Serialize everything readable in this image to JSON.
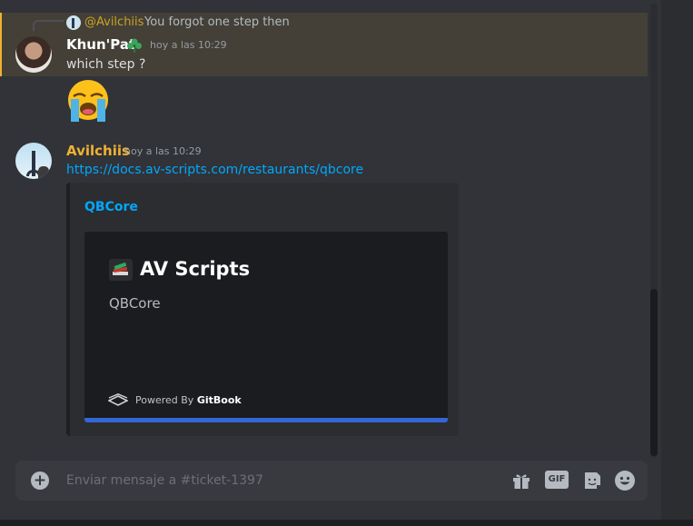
{
  "reply": {
    "mention": "@Avilchiis",
    "text": "You forgot one step then"
  },
  "messages": [
    {
      "author": "Khun'Pat",
      "author_color": "#ffffff",
      "timestamp": "hoy a las 10:29",
      "text": "which step ?",
      "emoji": "loudly-crying-face",
      "highlight_color": "#f0b232"
    },
    {
      "author": "Avilchiis",
      "author_color": "#f0b232",
      "timestamp": "hoy a las 10:29",
      "link": "https://docs.av-scripts.com/restaurants/qbcore",
      "embed": {
        "title": "QBCore",
        "site_name": "AV Scripts",
        "subtitle": "QBCore",
        "powered_prefix": "Powered By ",
        "powered_brand": "GitBook",
        "accent_color": "#3466d6"
      }
    }
  ],
  "composer": {
    "placeholder": "Enviar mensaje a #ticket-1397",
    "value": "",
    "gif_label": "GIF",
    "plus_label": "+"
  },
  "icons": [
    "plus-icon",
    "gift-icon",
    "gif-icon",
    "sticker-icon",
    "emoji-icon"
  ],
  "colors": {
    "link": "#00a8fc",
    "background": "#313338",
    "embed_bg": "#2b2d31"
  }
}
